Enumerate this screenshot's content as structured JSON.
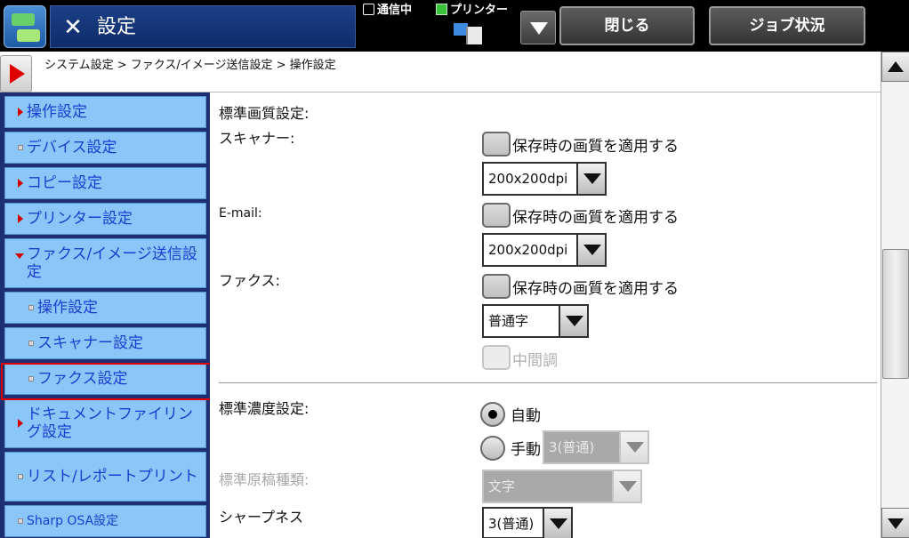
{
  "header": {
    "title": "設定",
    "status_comm": "通信中",
    "status_printer": "プリンター",
    "close_label": "閉じる",
    "job_status_label": "ジョブ状況"
  },
  "breadcrumb": {
    "text": "システム設定 > ファクス/イメージ送信設定 > 操作設定"
  },
  "sidebar": {
    "items": [
      {
        "label": "操作設定"
      },
      {
        "label": "デバイス設定"
      },
      {
        "label": "コピー設定"
      },
      {
        "label": "プリンター設定"
      },
      {
        "label": "ファクス/イメージ送信設定"
      },
      {
        "label": "操作設定"
      },
      {
        "label": "スキャナー設定"
      },
      {
        "label": "ファクス設定"
      },
      {
        "label": "ドキュメントファイリング設定"
      },
      {
        "label": "リスト/レポートプリント"
      },
      {
        "label": "Sharp OSA設定"
      }
    ],
    "selected": "ファクス設定"
  },
  "main": {
    "section_quality": "標準画質設定:",
    "scanner": {
      "label": "スキャナー:",
      "checkbox": "保存時の画質を適用する",
      "resolution": "200x200dpi"
    },
    "email": {
      "label": "E-mail:",
      "checkbox": "保存時の画質を適用する",
      "resolution": "200x200dpi"
    },
    "fax": {
      "label": "ファクス:",
      "checkbox": "保存時の画質を適用する",
      "resolution": "普通字",
      "halftone": "中間調"
    },
    "section_density": "標準濃度設定:",
    "density": {
      "auto": "自動",
      "manual": "手動",
      "manual_value": "3(普通)",
      "selected": "自動"
    },
    "original_type": {
      "label": "標準原稿種類:",
      "value": "文字"
    },
    "sharpness": {
      "label": "シャープネス",
      "value": "3(普通)"
    }
  }
}
